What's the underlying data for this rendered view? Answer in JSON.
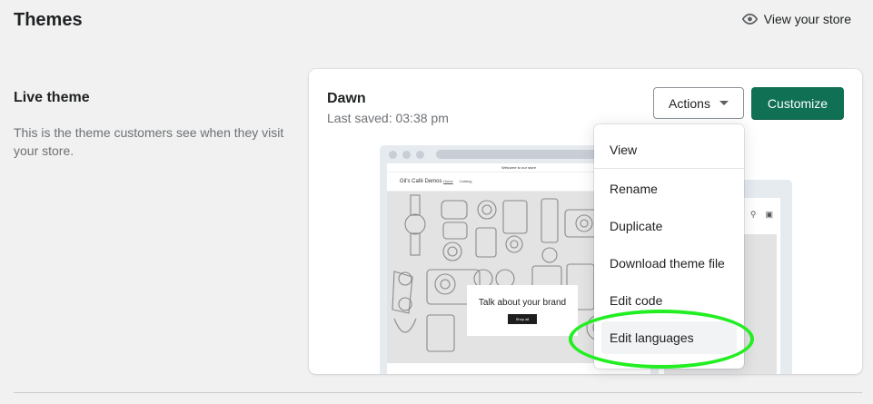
{
  "header": {
    "title": "Themes",
    "view_store_label": "View your store"
  },
  "live_section": {
    "title": "Live theme",
    "description": "This is the theme customers see when they visit your store."
  },
  "theme_card": {
    "name": "Dawn",
    "last_saved": "Last saved: 03:38 pm",
    "actions_label": "Actions",
    "customize_label": "Customize"
  },
  "preview": {
    "announcement": "Welcome to our store",
    "site_name": "Gil's Café Demos",
    "nav": [
      "Home",
      "Catalog"
    ],
    "hero_text": "Talk about your brand",
    "hero_button": "Shop all"
  },
  "actions_menu": {
    "items": [
      {
        "label": "View"
      },
      {
        "label": "Rename"
      },
      {
        "label": "Duplicate"
      },
      {
        "label": "Download theme file"
      },
      {
        "label": "Edit code"
      },
      {
        "label": "Edit languages"
      }
    ],
    "highlighted_item": "Edit languages"
  },
  "colors": {
    "primary": "#0f7053",
    "background": "#f1f1f1",
    "highlight_annotation": "#22ee22"
  }
}
